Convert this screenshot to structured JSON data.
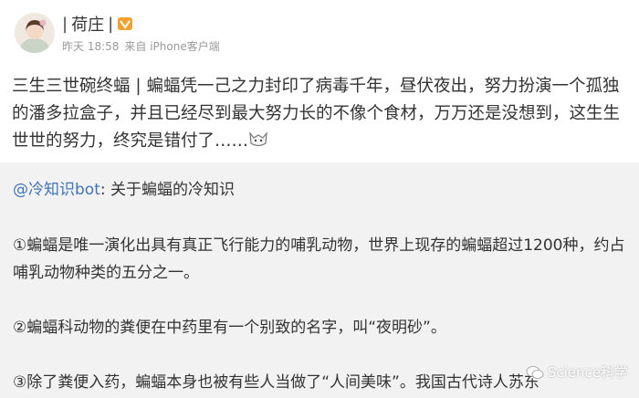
{
  "post": {
    "author": "荷庄",
    "bar": "|",
    "time": "昨天 18:58",
    "source": "来自 iPhone客户端",
    "text": "三生三世碗终蝠 | 蝙蝠凭一己之力封印了病毒千年，昼伏夜出，努力扮演一个孤独的潘多拉盒子，并且已经尽到最大努力长的不像个食材，万万还是没想到，这生生世世的努力，终究是错付了……",
    "emoji_icon": "doge-emoji-icon"
  },
  "repost": {
    "mention": "@冷知识bot",
    "intro": ": 关于蝙蝠的冷知识",
    "items": [
      "①蝙蝠是唯一演化出具有真正飞行能力的哺乳动物，世界上现存的蝙蝠超过1200种，约占哺乳动物种类的五分之一。",
      "②蝙蝠科动物的粪便在中药里有一个别致的名字，叫“夜明砂”。",
      "③除了粪便入药，蝙蝠本身也被有些人当做了“人间美味”。我国古代诗人苏东"
    ]
  },
  "watermark": {
    "text": "Science科学"
  },
  "colors": {
    "link": "#3f75b8",
    "repost_bg": "#f2f2f2",
    "meta": "#9a9a9a"
  }
}
